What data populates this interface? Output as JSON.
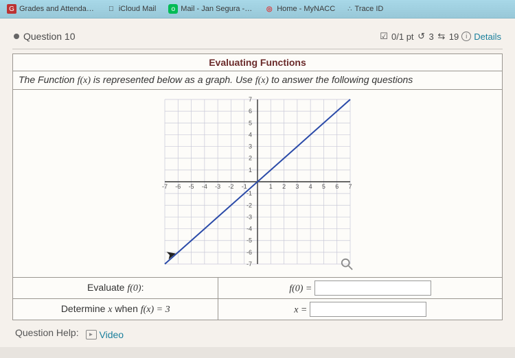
{
  "tabs": {
    "t0": "Grades and Attenda…",
    "t1": "iCloud Mail",
    "t2": "Mail - Jan Segura -…",
    "t3": "Home - MyNACC",
    "t4": "Trace ID"
  },
  "question": {
    "label": "Question 10",
    "score": "0/1 pt",
    "attempts": "3",
    "retries": "19",
    "details": "Details"
  },
  "card": {
    "title": "Evaluating Functions",
    "instr_pre": "The Function ",
    "instr_fx1": "f(x)",
    "instr_mid": " is represented below as a graph. Use ",
    "instr_fx2": "f(x)",
    "instr_post": " to answer the following questions"
  },
  "rows": {
    "r1_label_pre": "Evaluate ",
    "r1_label_fx": "f(0)",
    "r1_label_post": ":",
    "r1_rhs_fx": "f(0) =",
    "r2_label_pre": "Determine ",
    "r2_label_x": "x",
    "r2_label_mid": " when ",
    "r2_label_fx": "f(x) = 3",
    "r2_rhs_fx": "x ="
  },
  "help": {
    "label": "Question Help:",
    "video": "Video"
  },
  "chart_data": {
    "type": "line",
    "title": "",
    "xlabel": "",
    "ylabel": "",
    "xlim": [
      -7,
      7
    ],
    "ylim": [
      -7,
      7
    ],
    "grid": true,
    "x": [
      -7,
      7
    ],
    "y": [
      -7,
      7
    ],
    "series": [
      {
        "name": "f(x)",
        "x": [
          -7,
          -6,
          -5,
          -4,
          -3,
          -2,
          -1,
          0,
          1,
          2,
          3,
          4,
          5,
          6,
          7
        ],
        "y": [
          -7,
          -6,
          -5,
          -4,
          -3,
          -2,
          -1,
          0,
          1,
          2,
          3,
          4,
          5,
          6,
          7
        ]
      }
    ],
    "x_ticks": [
      -7,
      -6,
      -5,
      -4,
      -3,
      -2,
      -1,
      1,
      2,
      3,
      4,
      5,
      6,
      7
    ],
    "y_ticks": [
      -7,
      -6,
      -5,
      -4,
      -3,
      -2,
      -1,
      1,
      2,
      3,
      4,
      5,
      6,
      7
    ]
  }
}
